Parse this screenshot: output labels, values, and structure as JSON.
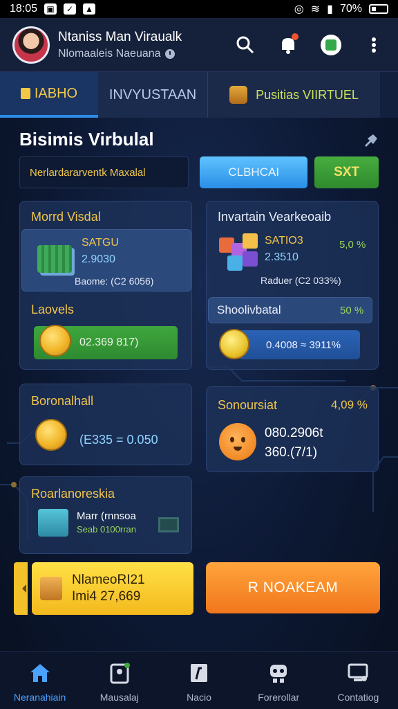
{
  "status_bar": {
    "time": "18:05",
    "battery": "70%"
  },
  "app_bar": {
    "user_name": "Ntaniss Man Viraualk",
    "user_subtitle": "Nlomaaleis Naeuana"
  },
  "tabs": [
    {
      "label": "IABHO"
    },
    {
      "label": "INVYUSTAAN"
    },
    {
      "label": "Pusitias VIIRTUEL"
    }
  ],
  "section": {
    "title": "Bisimis Virbulal",
    "filter_value": "Nerlardararventk Maxalal",
    "button_blue": "CLBHCAI",
    "button_green": "SXT"
  },
  "cards": {
    "money_visual": {
      "title": "Morrd Visdal",
      "stat_label": "SATGU",
      "stat_value": "2.9030",
      "note": "Baome: (C2 6056)"
    },
    "investment": {
      "title": "Invartain Vearkeoaib",
      "stat_label": "SATIO3",
      "stat_value": "2.3510",
      "pct": "5,0 %",
      "note": "Raduer (C2 033%)"
    },
    "levels": {
      "title": "Laovels",
      "bar_text": "02.369 817)"
    },
    "shopping": {
      "title": "Shoolivbatal",
      "pct": "50 %",
      "bar_text": "0.4008 ≈ 3911%"
    },
    "earnings": {
      "title": "Boronalhall",
      "value": "(E335 = 0.050"
    },
    "somourslat": {
      "title": "Sonoursiat",
      "pct": "4,09 %",
      "value_line1": "080.2906t",
      "value_line2": "360.(7/1)"
    },
    "randomness": {
      "title": "Roarlanoreskia",
      "line1": "Marr (rnnsoa",
      "line2": "Seab 0100rran"
    }
  },
  "cta": {
    "yellow_line1": "NlameoRI21",
    "yellow_line2": "Imi4 27,669",
    "orange": "R NOAKEAM"
  },
  "bottom_nav": [
    {
      "label": "Neranahiain",
      "icon": "home-icon"
    },
    {
      "label": "Mausalaj",
      "icon": "user-badge-icon"
    },
    {
      "label": "Nacio",
      "icon": "document-icon"
    },
    {
      "label": "Forerollar",
      "icon": "robot-icon"
    },
    {
      "label": "Contatiog",
      "icon": "computer-icon"
    }
  ],
  "colors": {
    "accent_blue": "#2d8ce6",
    "accent_gold": "#f1c54a",
    "green": "#3fa73d",
    "orange": "#f1761c"
  }
}
